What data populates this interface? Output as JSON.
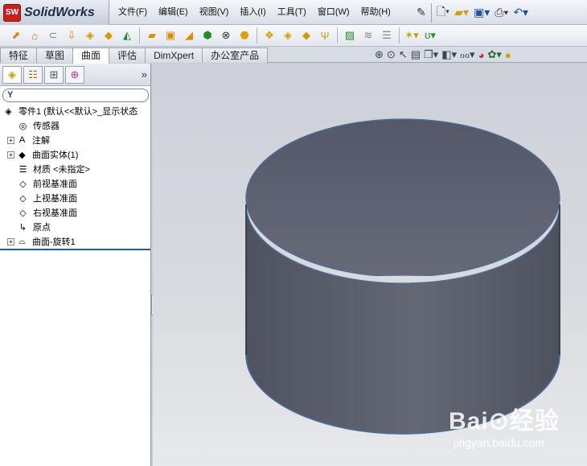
{
  "app": {
    "logo_badge": "SW",
    "name": "SolidWorks"
  },
  "menu": [
    "文件(F)",
    "编辑(E)",
    "视图(V)",
    "插入(I)",
    "工具(T)",
    "窗口(W)",
    "帮助(H)"
  ],
  "tabs": [
    {
      "label": "特征",
      "active": false
    },
    {
      "label": "草图",
      "active": false
    },
    {
      "label": "曲面",
      "active": true
    },
    {
      "label": "评估",
      "active": false
    },
    {
      "label": "DimXpert",
      "active": false
    },
    {
      "label": "办公室产品",
      "active": false
    }
  ],
  "panel": {
    "expand_symbol": "»",
    "filter_symbol": "Y",
    "tree": [
      {
        "label": "零件1  (默认<<默认>_显示状态",
        "icon": "part-icon",
        "glyph": "◈",
        "level": 0,
        "expandable": false
      },
      {
        "label": "传感器",
        "icon": "sensor-icon",
        "glyph": "◎",
        "level": 1,
        "expandable": false
      },
      {
        "label": "注解",
        "icon": "annotation-icon",
        "glyph": "A",
        "level": 1,
        "expandable": true
      },
      {
        "label": "曲面实体(1)",
        "icon": "surface-body-icon",
        "glyph": "◆",
        "level": 1,
        "expandable": true
      },
      {
        "label": "材质 <未指定>",
        "icon": "material-icon",
        "glyph": "☰",
        "level": 1,
        "expandable": false
      },
      {
        "label": "前视基准面",
        "icon": "plane-icon",
        "glyph": "◇",
        "level": 1,
        "expandable": false
      },
      {
        "label": "上视基准面",
        "icon": "plane-icon",
        "glyph": "◇",
        "level": 1,
        "expandable": false
      },
      {
        "label": "右视基准面",
        "icon": "plane-icon",
        "glyph": "◇",
        "level": 1,
        "expandable": false
      },
      {
        "label": "原点",
        "icon": "origin-icon",
        "glyph": "↳",
        "level": 1,
        "expandable": false
      },
      {
        "label": "曲面-旋转1",
        "icon": "revolve-surface-icon",
        "glyph": "⌓",
        "level": 1,
        "expandable": true
      }
    ]
  },
  "watermark": {
    "brand": "Bai⊙经验",
    "site": "jingyan.baidu.com"
  },
  "colors": {
    "accent": "#1a5fb4",
    "model_fill": "#5d6270",
    "edge": "#4a6f99"
  }
}
